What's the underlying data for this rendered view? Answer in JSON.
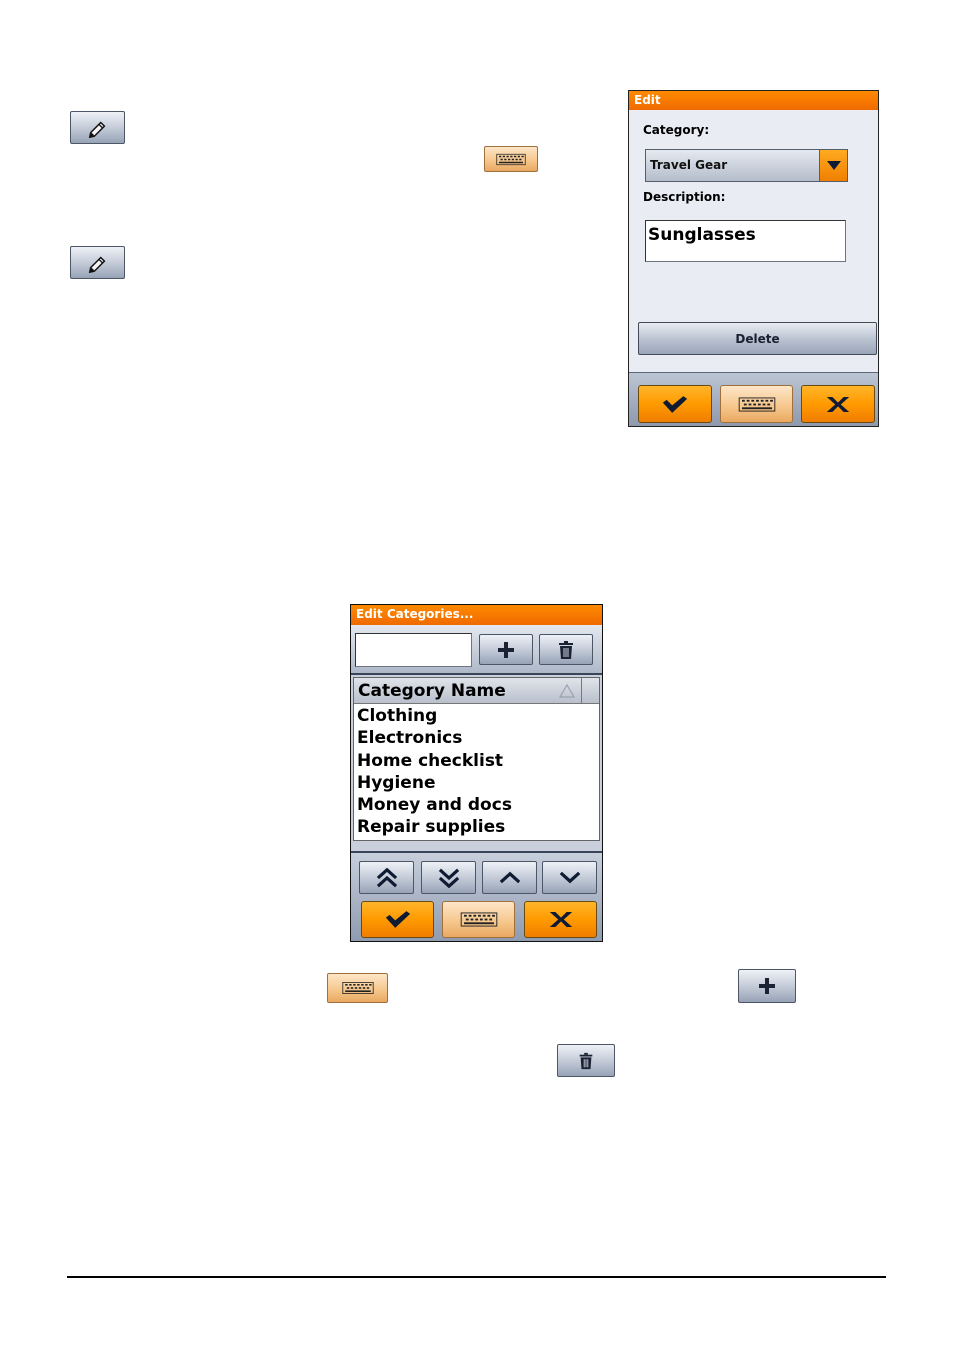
{
  "edit_dialog": {
    "title": "Edit",
    "category_label": "Category:",
    "category_value": "Travel Gear",
    "description_label": "Description:",
    "description_value": "Sunglasses",
    "delete_label": "Delete"
  },
  "categories_dialog": {
    "title": "Edit Categories...",
    "new_category_value": "",
    "column_header": "Category Name",
    "items": [
      "Clothing",
      "Electronics",
      "Home checklist",
      "Hygiene",
      "Money and docs",
      "Repair supplies"
    ]
  },
  "icons": {
    "edit": "pencil-icon",
    "keyboard": "keyboard-icon",
    "add": "plus-icon",
    "delete": "trash-icon",
    "ok": "checkmark-icon",
    "cancel": "x-icon"
  },
  "colors": {
    "title_bar": "#f06a00",
    "orange_button": "#ff9a00",
    "dialog_bg": "#e9edf3"
  }
}
